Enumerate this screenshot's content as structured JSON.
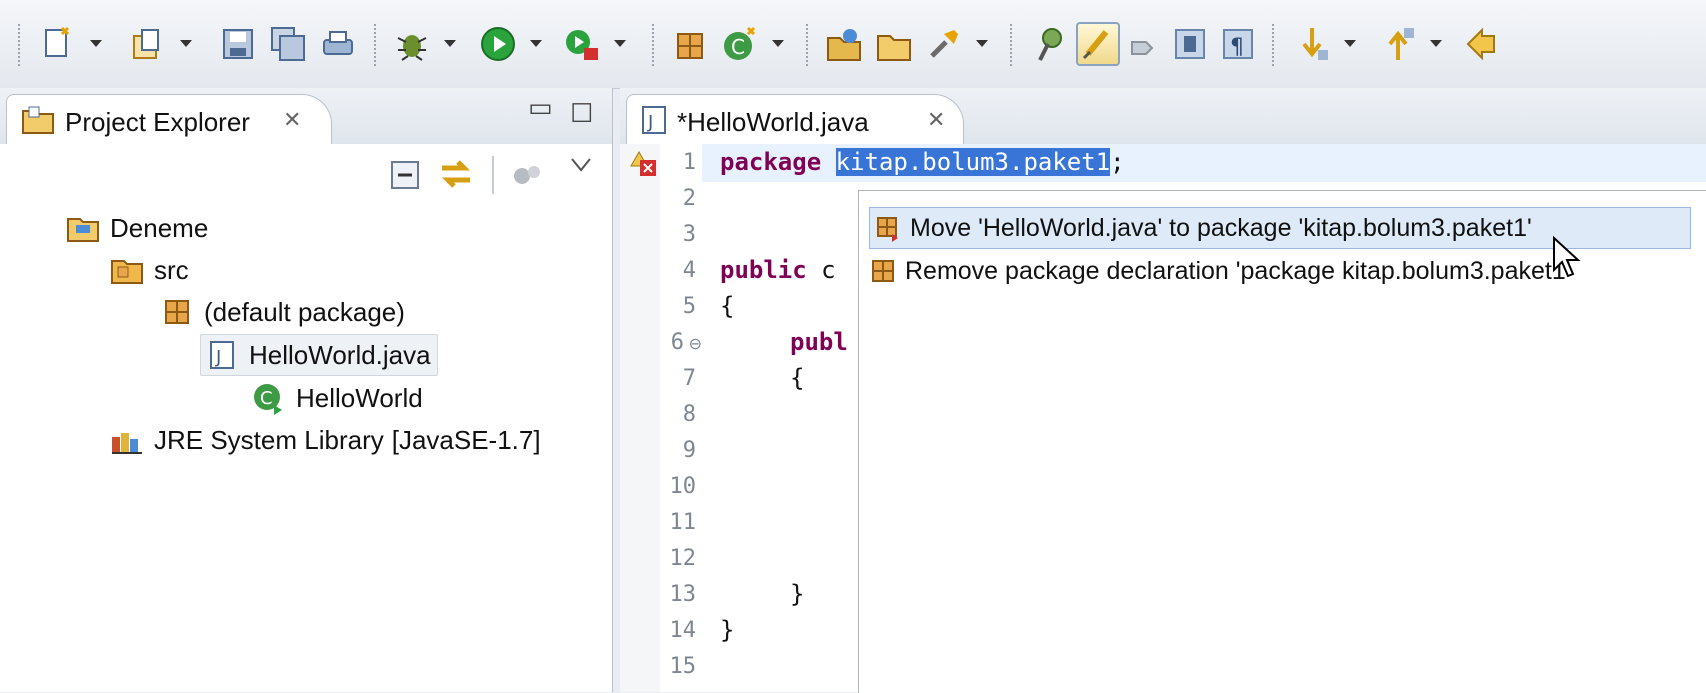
{
  "toolbar": {
    "icons": [
      "new-wizard-icon",
      "new-project-icon",
      "save-icon",
      "save-all-icon",
      "print-icon",
      "debug-icon",
      "run-icon",
      "external-tools-icon",
      "new-package-icon",
      "new-class-icon",
      "open-type-icon",
      "open-resource-icon",
      "search-icon",
      "toggle-breadcrumb-icon",
      "mark-occurrences-icon",
      "block-selection-icon",
      "show-whitespace-icon",
      "pilcrow-icon",
      "next-annotation-icon",
      "previous-annotation-icon",
      "back-icon"
    ]
  },
  "project_explorer": {
    "tab_title": "Project Explorer",
    "tree": [
      {
        "label": "Deneme",
        "icon": "java-project-icon",
        "level": 0
      },
      {
        "label": "src",
        "icon": "source-folder-icon",
        "level": 1
      },
      {
        "label": "(default package)",
        "icon": "package-icon",
        "level": 2
      },
      {
        "label": "HelloWorld.java",
        "icon": "java-file-icon",
        "level": 3,
        "selected": true
      },
      {
        "label": "HelloWorld",
        "icon": "class-icon",
        "level": 4
      },
      {
        "label": "JRE System Library",
        "suffix": "[JavaSE-1.7]",
        "icon": "library-icon",
        "level": 1
      }
    ]
  },
  "editor": {
    "tab_title": "*HelloWorld.java",
    "line_numbers": [
      "1",
      "2",
      "3",
      "4",
      "5",
      "6",
      "7",
      "8",
      "9",
      "10",
      "11",
      "12",
      "13",
      "14",
      "15"
    ],
    "code": {
      "l1_kw": "package",
      "l1_sel": "kitap.bolum3.paket1",
      "l1_end": ";",
      "l4_kw": "public",
      "l4_rest": " c",
      "l5": "{",
      "l6_kw": "publ",
      "l7": "{",
      "l13": "}",
      "l14": "}"
    }
  },
  "quick_fix": {
    "items": [
      {
        "label": "Move 'HelloWorld.java' to package 'kitap.bolum3.paket1'",
        "selected": true
      },
      {
        "label": "Remove package declaration 'package kitap.bolum3.paket1'",
        "selected": false
      }
    ]
  }
}
